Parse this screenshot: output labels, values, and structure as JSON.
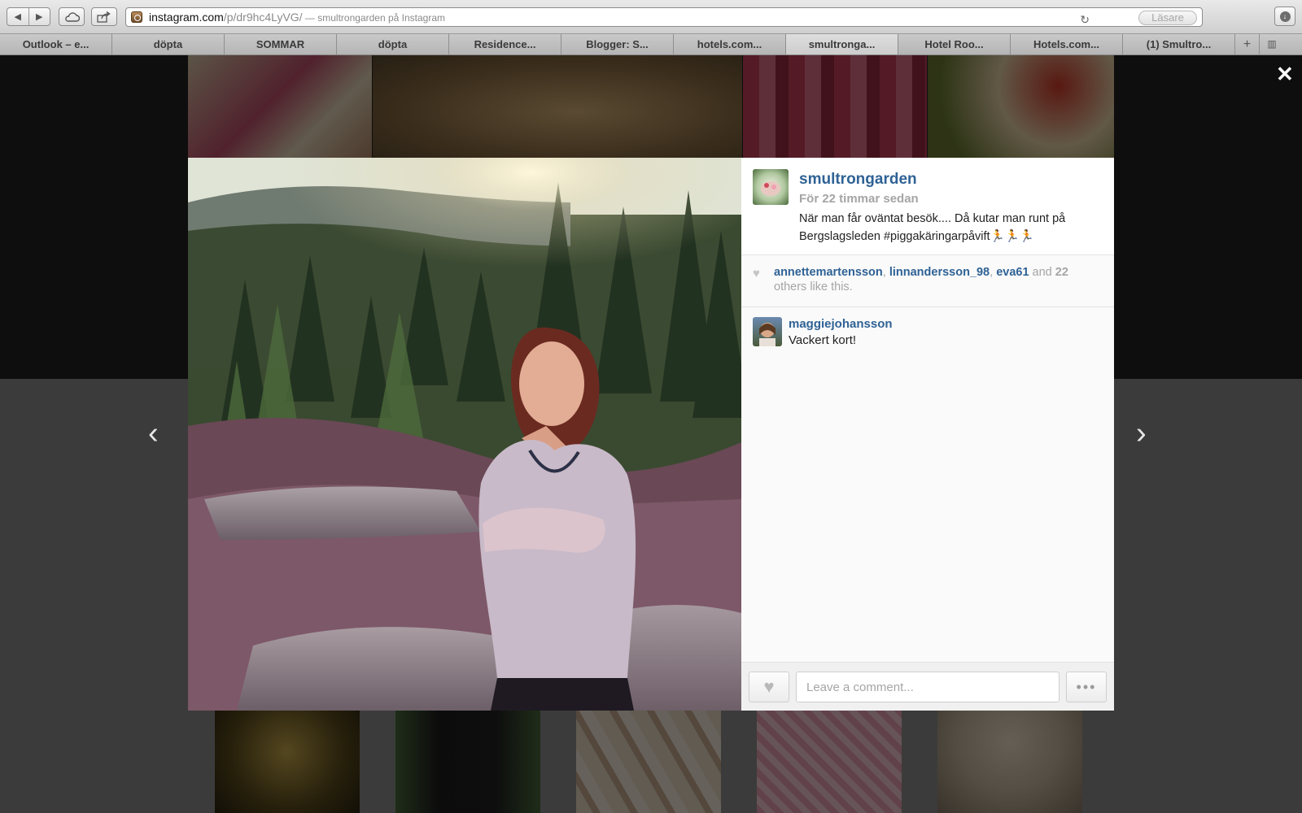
{
  "browser": {
    "url_host": "instagram.com",
    "url_path": "/p/dr9hc4LyVG/",
    "url_separator": " — ",
    "page_title": "smultrongarden på Instagram",
    "reader_label": "Läsare",
    "tabs": [
      {
        "label": "Outlook – e..."
      },
      {
        "label": "döpta"
      },
      {
        "label": "SOMMAR"
      },
      {
        "label": "döpta"
      },
      {
        "label": "Residence..."
      },
      {
        "label": "Blogger: S..."
      },
      {
        "label": "hotels.com..."
      },
      {
        "label": "smultronga...",
        "active": true
      },
      {
        "label": "Hotel Roo..."
      },
      {
        "label": "Hotels.com..."
      },
      {
        "label": "(1) Smultro..."
      }
    ],
    "new_tab_label": "+"
  },
  "post": {
    "username": "smultrongarden",
    "time_ago": "För 22 timmar sedan",
    "caption": "När man får oväntat besök.... Då kutar man runt på Bergslagsleden #piggakäringarpåvift🏃🏃🏃",
    "likes": {
      "likers": [
        "annettemartensson",
        "linnandersson_98",
        "eva61"
      ],
      "and_label": "and",
      "others_count": "22",
      "others_suffix": "others like this."
    },
    "comments": [
      {
        "user": "maggiejohansson",
        "text": "Vackert kort!"
      }
    ],
    "comment_placeholder": "Leave a comment...",
    "more_label": "•••"
  },
  "icons": {
    "close": "close-icon",
    "prev": "chevron-left-icon",
    "next": "chevron-right-icon",
    "heart": "heart-icon"
  }
}
